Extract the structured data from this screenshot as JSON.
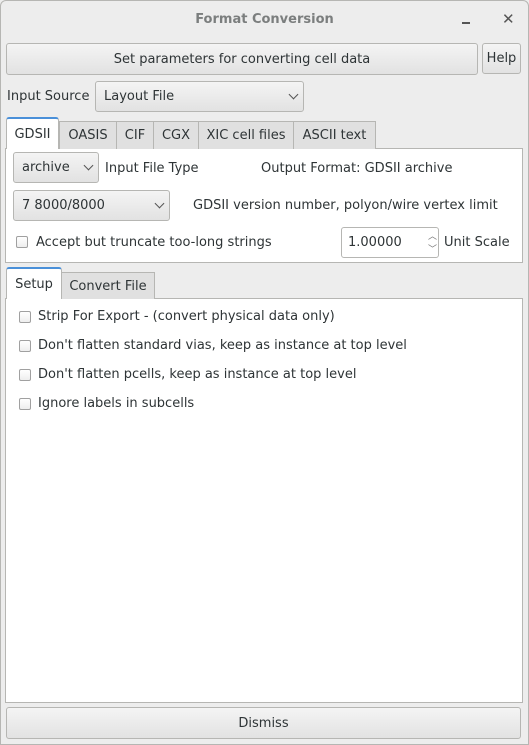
{
  "window": {
    "title": "Format Conversion",
    "minimize_icon": "minimize-icon",
    "close_icon": "close-icon"
  },
  "header": {
    "description": "Set parameters for converting cell data",
    "help_label": "Help"
  },
  "input_source": {
    "label": "Input Source",
    "value": "Layout File"
  },
  "format_tabs": [
    {
      "label": "GDSII",
      "active": true
    },
    {
      "label": "OASIS"
    },
    {
      "label": "CIF"
    },
    {
      "label": "CGX"
    },
    {
      "label": "XIC cell files"
    },
    {
      "label": "ASCII text"
    }
  ],
  "gdsii": {
    "input_file_type_value": "archive",
    "input_file_type_label": "Input File Type",
    "output_format": "Output Format:  GDSII archive",
    "version_value": "7  8000/8000",
    "version_label": "GDSII version number, polyon/wire vertex limit",
    "truncate_label": "Accept but truncate too-long strings",
    "truncate_checked": false,
    "unit_scale_value": "1.00000",
    "unit_scale_label": "Unit Scale"
  },
  "sub_tabs": [
    {
      "label": "Setup",
      "active": true
    },
    {
      "label": "Convert File"
    }
  ],
  "setup_options": [
    {
      "label": "Strip For Export - (convert physical data only)",
      "checked": false
    },
    {
      "label": "Don't flatten standard vias, keep as instance at top level",
      "checked": false
    },
    {
      "label": "Don't flatten pcells, keep as instance at top level",
      "checked": false
    },
    {
      "label": "Ignore labels in subcells",
      "checked": false
    }
  ],
  "footer": {
    "dismiss_label": "Dismiss"
  }
}
